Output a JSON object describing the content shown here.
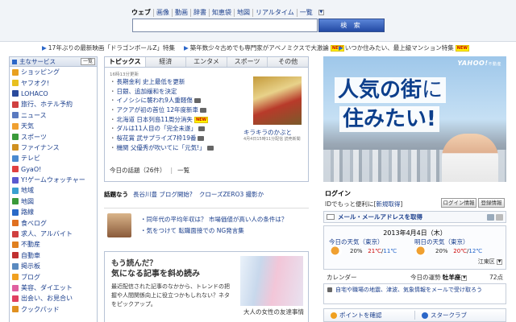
{
  "search": {
    "tabs": [
      "ウェブ",
      "画像",
      "動画",
      "辞書",
      "知恵袋",
      "地図",
      "リアルタイム",
      "一覧"
    ],
    "active_tab": "ウェブ",
    "query": "",
    "button_label": "検 索"
  },
  "ticker": [
    {
      "text": "17年ぶりの最新映画「ドラゴンボールZ」特集",
      "badge": ""
    },
    {
      "text": "築年数少々古めでも専門家がアベノミクスで大激論",
      "badge": "NEW"
    },
    {
      "text": "いつか住みたい、最上級マンション特集",
      "badge": "NEW"
    }
  ],
  "sidebar": {
    "title": "主なサービス",
    "list_button": "一覧",
    "items": [
      {
        "label": "ショッピング",
        "color": "#e8a020"
      },
      {
        "label": "ヤフオク!",
        "color": "#e8c020"
      },
      {
        "label": "LOHACO",
        "color": "#2a4a9c"
      },
      {
        "label": "旅行、ホテル予約",
        "color": "#d04040"
      },
      {
        "label": "ニュース",
        "color": "#5a7ac0"
      },
      {
        "label": "天気",
        "color": "#f0a030"
      },
      {
        "label": "スポーツ",
        "color": "#3a9a3a"
      },
      {
        "label": "ファイナンス",
        "color": "#d09020"
      },
      {
        "label": "テレビ",
        "color": "#4a8ad0"
      },
      {
        "label": "GyaO!",
        "color": "#e04040"
      },
      {
        "label": "Y!ゲームウォッチャー",
        "color": "#5a5ad0"
      },
      {
        "label": "地域",
        "color": "#3aa0d0"
      },
      {
        "label": "地図",
        "color": "#3a9a3a"
      },
      {
        "label": "路線",
        "color": "#2a6ac8"
      },
      {
        "label": "食べログ",
        "color": "#e07020"
      },
      {
        "label": "求人、アルバイト",
        "color": "#d04040"
      },
      {
        "label": "不動産",
        "color": "#e08020"
      },
      {
        "label": "自動車",
        "color": "#c03030"
      },
      {
        "label": "掲示板",
        "color": "#5a8ac0"
      },
      {
        "label": "ブログ",
        "color": "#f0a020"
      },
      {
        "label": "美容、ダイエット",
        "color": "#e060a0"
      },
      {
        "label": "出会い、お見合い",
        "color": "#e04060"
      },
      {
        "label": "クックパッド",
        "color": "#e09020"
      }
    ]
  },
  "news": {
    "tabs": [
      "トピックス",
      "経済",
      "エンタメ",
      "スポーツ",
      "その他"
    ],
    "active_tab": "トピックス",
    "updated": "16時13分更新",
    "items": [
      {
        "text": "長期金利 史上最低を更新",
        "camera": false,
        "badge": ""
      },
      {
        "text": "日銀、追加緩和を決定",
        "camera": false,
        "badge": ""
      },
      {
        "text": "イノシシに襲われ9人重軽傷",
        "camera": true,
        "badge": ""
      },
      {
        "text": "アクアが初の首位 12年度新車",
        "camera": true,
        "badge": ""
      },
      {
        "text": "北海道 日本列島11周分消失",
        "camera": false,
        "badge": "NEW"
      },
      {
        "text": "ダルは11人目の「完全未遂」",
        "camera": true,
        "badge": ""
      },
      {
        "text": "桜花賞 武サプライズ7枠19番",
        "camera": true,
        "badge": ""
      },
      {
        "text": "機関 父優秀が吹いてに「元気!」",
        "camera": true,
        "badge": ""
      }
    ],
    "more_label": "今日の話題（26件）",
    "list_label": "一覧",
    "photo_caption": "キラキラのかぶと",
    "photo_sub": "4月4日15時11分配信 読売新聞"
  },
  "hot_topics": {
    "label": "話題なう",
    "items": [
      "長谷川豊 ブログ開始?",
      "クローズZERO3 撮影か"
    ]
  },
  "qa": {
    "lines": [
      "・同年代の平均年収は？ 市場価値が高い人の条件は？",
      "・気をつけて 転職面接での NG発言集"
    ]
  },
  "matome": {
    "title1": "もう読んだ？",
    "title2": "気になる記事を斜め読み",
    "desc": "最近配信された記事のなかから、トレンドの把握や人間関係向上に役立つかもしれない？ネタをピックアップ。",
    "caption": "大人の女性の友達事情"
  },
  "ad": {
    "logo": "YAHOO!",
    "logo_sub": "不動産",
    "line1a": "人気の街",
    "line1b": "に",
    "line2": "住みたい!"
  },
  "login": {
    "title": "ログイン",
    "sub": "IDでもっと便利に[",
    "sub_link": "新規取得",
    "sub_end": "]",
    "login_button": "ログイン情報",
    "settings_button": "登録情報",
    "mail_label": "メール・メールアドレスを取得"
  },
  "weather": {
    "date": "2013年4月4日（木）",
    "today": {
      "label": "今日の天気（東京）",
      "percent": "20%",
      "high": "21℃",
      "low": "11℃",
      "icon_color": "#f0a030"
    },
    "tomorrow": {
      "label": "明日の天気（東京）",
      "percent": "20%",
      "high": "20℃",
      "low": "12℃",
      "icon_color": "#f0a030"
    },
    "region": "江東区"
  },
  "calendar": {
    "label": "カレンダー",
    "luck_label": "今日の運勢",
    "luck_sign": "牡羊座",
    "points": "72点"
  },
  "alert": {
    "text": "自宅や職場の地震、津波、気象情報をメールで受け取ろう"
  },
  "bottom": {
    "points": "ポイントを確認",
    "star": "スタークラブ"
  }
}
